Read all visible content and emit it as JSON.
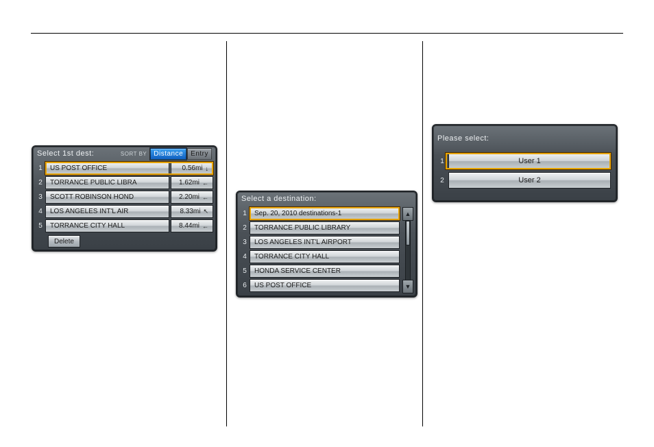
{
  "screenA": {
    "title": "Select 1st dest:",
    "sort_label": "SORT BY",
    "sort_options": {
      "distance": "Distance",
      "entry": "Entry"
    },
    "items": [
      {
        "num": "1",
        "name": "US POST OFFICE",
        "dist": "0.56mi",
        "arrow": "↓"
      },
      {
        "num": "2",
        "name": "TORRANCE PUBLIC LIBRA",
        "dist": "1.62mi",
        "arrow": "←"
      },
      {
        "num": "3",
        "name": "SCOTT ROBINSON HOND",
        "dist": "2.20mi",
        "arrow": "←"
      },
      {
        "num": "4",
        "name": "LOS ANGELES INT'L AIR",
        "dist": "8.33mi",
        "arrow": "↖"
      },
      {
        "num": "5",
        "name": "TORRANCE CITY HALL",
        "dist": "8.44mi",
        "arrow": "←"
      }
    ],
    "delete_label": "Delete"
  },
  "screenB": {
    "title": "Select a destination:",
    "items": [
      {
        "num": "1",
        "name": "Sep. 20, 2010 destinations-1"
      },
      {
        "num": "2",
        "name": "TORRANCE PUBLIC LIBRARY"
      },
      {
        "num": "3",
        "name": "LOS ANGELES INT'L AIRPORT"
      },
      {
        "num": "4",
        "name": "TORRANCE CITY HALL"
      },
      {
        "num": "5",
        "name": "HONDA SERVICE CENTER"
      },
      {
        "num": "6",
        "name": "US POST OFFICE"
      }
    ],
    "scroll_up": "▲",
    "scroll_down": "▼"
  },
  "screenC": {
    "title": "Please select:",
    "items": [
      {
        "num": "1",
        "name": "User 1"
      },
      {
        "num": "2",
        "name": "User 2"
      }
    ]
  }
}
